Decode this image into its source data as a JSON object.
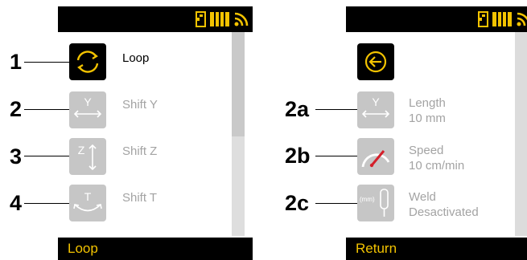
{
  "left_screen": {
    "bottom_label": "Loop",
    "items": [
      {
        "callout": "1",
        "label": "Loop",
        "icon": "loop-icon",
        "state": "active"
      },
      {
        "callout": "2",
        "label": "Shift Y",
        "icon": "shift-y-icon",
        "state": "inactive",
        "icon_text": "Y"
      },
      {
        "callout": "3",
        "label": "Shift Z",
        "icon": "shift-z-icon",
        "state": "inactive",
        "icon_text": "Z"
      },
      {
        "callout": "4",
        "label": "Shift T",
        "icon": "shift-t-icon",
        "state": "inactive",
        "icon_text": "T"
      }
    ]
  },
  "right_screen": {
    "bottom_label": "Return",
    "items": [
      {
        "callout": "",
        "label": "",
        "icon": "return-arrow-icon",
        "state": "active"
      },
      {
        "callout": "2a",
        "label": "Length",
        "value": "10 mm",
        "icon": "length-icon",
        "state": "inactive",
        "icon_text": "Y"
      },
      {
        "callout": "2b",
        "label": "Speed",
        "value": "10 cm/min",
        "icon": "speed-gauge-icon",
        "state": "inactive"
      },
      {
        "callout": "2c",
        "label": "Weld",
        "value": "Desactivated",
        "icon": "weld-torch-icon",
        "state": "inactive",
        "icon_text": "(mm)"
      }
    ]
  },
  "colors": {
    "accent": "#f3c300",
    "bar": "#000000",
    "inactive_icon": "#c6c6c6",
    "inactive_text": "#a3a3a3",
    "gauge_needle": "#d41f2a"
  },
  "status_icons": [
    "memory-card-icon",
    "battery-icon",
    "wifi-icon"
  ]
}
